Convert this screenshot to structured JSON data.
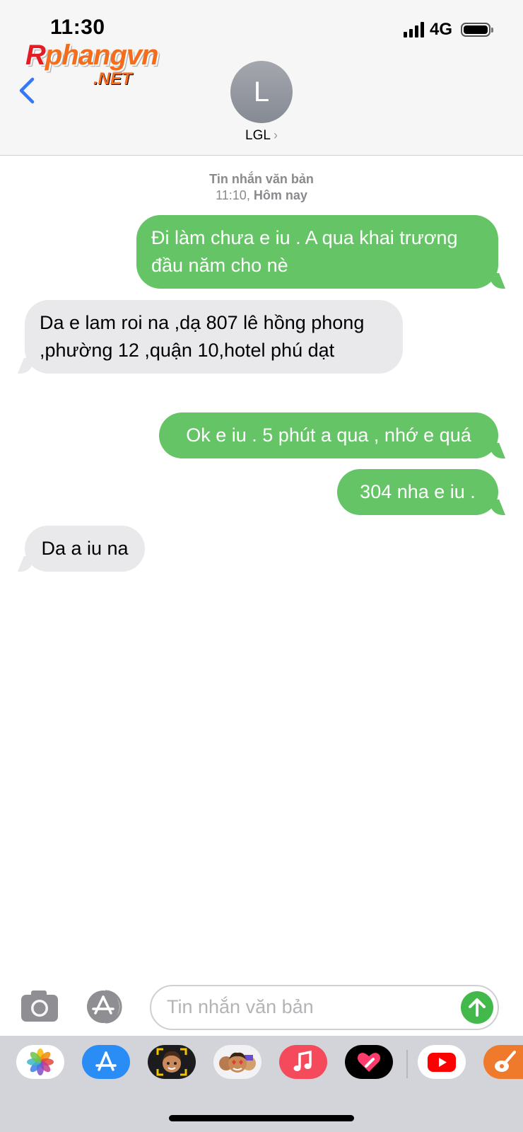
{
  "status_bar": {
    "time": "11:30",
    "network": "4G"
  },
  "watermark": {
    "main_first": "R",
    "main_rest": "phangvn",
    "sub": ".NET"
  },
  "header": {
    "avatar_letter": "L",
    "contact_name": "LGL"
  },
  "thread": {
    "label": "Tin nhắn văn bản",
    "timestamp_time": "11:10,",
    "timestamp_day": "Hôm nay",
    "messages": [
      {
        "direction": "outgoing",
        "text": "Đi làm chưa e iu . A qua khai trương đầu năm cho nè"
      },
      {
        "direction": "incoming",
        "text": "Da e lam roi na ,dạ 807 lê hồng phong ,phường 12 ,quận 10,hotel phú dạt"
      },
      {
        "direction": "outgoing",
        "text": "Ok e iu . 5 phút a qua , nhớ e quá"
      },
      {
        "direction": "outgoing",
        "text": "304 nha e iu ."
      },
      {
        "direction": "incoming",
        "text": "Da a iu na"
      }
    ]
  },
  "composer": {
    "placeholder": "Tin nhắn văn bản"
  },
  "app_drawer": {
    "apps": [
      "photos-icon",
      "app-store-icon",
      "memoji-camera-icon",
      "memoji-stickers-icon",
      "music-icon",
      "digital-touch-icon",
      "youtube-icon",
      "garageband-icon"
    ]
  },
  "colors": {
    "outgoing_bubble": "#65c466",
    "incoming_bubble": "#e9e9eb",
    "accent_blue": "#3478f6",
    "send_button": "#42b94a"
  }
}
